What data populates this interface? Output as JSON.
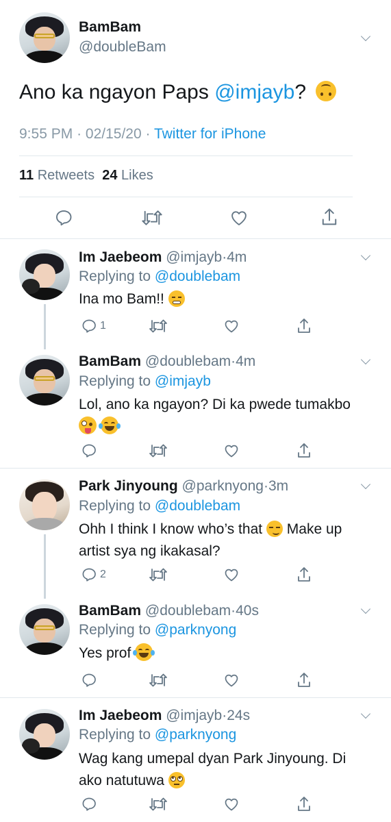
{
  "main_tweet": {
    "name": "BamBam",
    "handle": "@doubleBam",
    "text": "Ano ka ngayon Paps ",
    "mention": "@imjayb",
    "text_end": "?",
    "time": "9:55 PM",
    "date": "02/15/20",
    "source": "Twitter for iPhone",
    "retweets_count": "11",
    "retweets_label": "Retweets",
    "likes_count": "24",
    "likes_label": "Likes"
  },
  "replies": [
    {
      "name": "Im Jaebeom",
      "handle": "@imjayb",
      "time": "4m",
      "replying_label": "Replying to",
      "replying_to": "@doublebam",
      "text": "Ina mo Bam!!",
      "reply_count": "1"
    },
    {
      "name": "BamBam",
      "handle": "@doublebam",
      "time": "4m",
      "replying_label": "Replying to",
      "replying_to": "@imjayb",
      "text": "Lol, ano ka ngayon? Di ka pwede tumakbo",
      "reply_count": ""
    },
    {
      "name": "Park Jinyoung",
      "handle": "@parknyong",
      "time": "3m",
      "replying_label": "Replying to",
      "replying_to": "@doublebam",
      "text_line1": "Ohh I think I know who’s that",
      "text_line1_end": "Make up",
      "text_line2": "artist sya ng ikakasal?",
      "reply_count": "2"
    },
    {
      "name": "BamBam",
      "handle": "@doublebam",
      "time": "40s",
      "replying_label": "Replying to",
      "replying_to": "@parknyong",
      "text": "Yes prof",
      "reply_count": ""
    },
    {
      "name": "Im Jaebeom",
      "handle": "@imjayb",
      "time": "24s",
      "replying_label": "Replying to",
      "replying_to": "@parknyong",
      "text_line1": "Wag kang umepal dyan Park Jinyoung. Di",
      "text_line2": "ako natutuwa",
      "reply_count": ""
    }
  ],
  "separator": "·",
  "icons": [
    "reply-icon",
    "retweet-icon",
    "like-icon",
    "share-icon",
    "chevron-down-icon"
  ],
  "colors": {
    "link": "#1b95e0",
    "secondary": "#657786",
    "divider": "#e1e8ed"
  }
}
